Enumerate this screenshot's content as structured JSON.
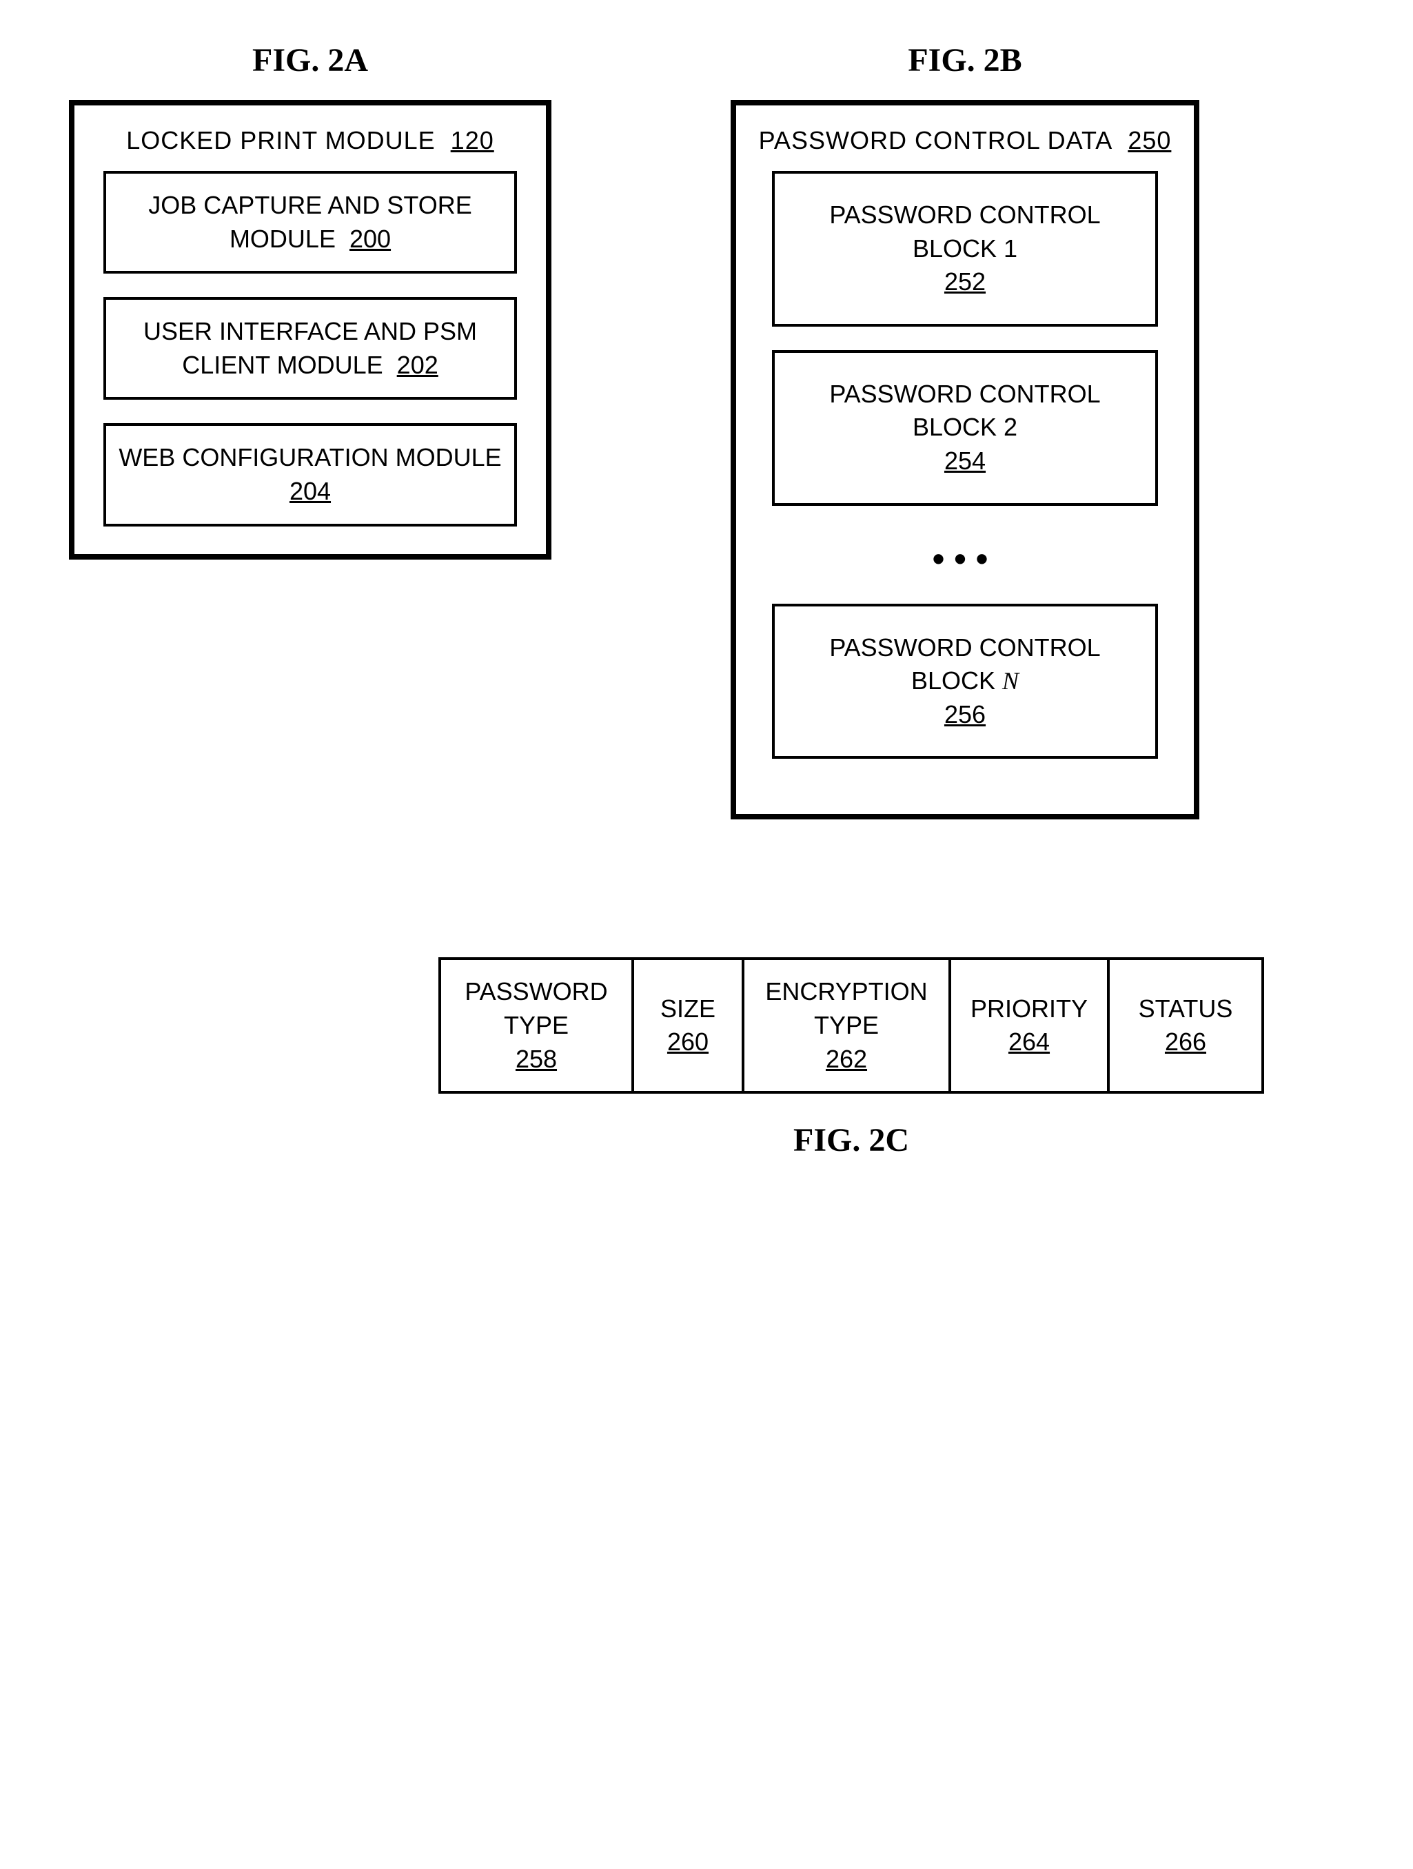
{
  "figA": {
    "label": "FIG. 2A",
    "header_text": "LOCKED PRINT MODULE",
    "header_num": "120",
    "boxes": [
      {
        "text": "JOB CAPTURE AND STORE MODULE",
        "num": "200"
      },
      {
        "text": "USER INTERFACE AND PSM CLIENT MODULE",
        "num": "202"
      },
      {
        "text": "WEB CONFIGURATION MODULE",
        "num": "204"
      }
    ]
  },
  "figB": {
    "label": "FIG. 2B",
    "header_text": "PASSWORD CONTROL DATA",
    "header_num": "250",
    "boxes": [
      {
        "text": "PASSWORD CONTROL BLOCK 1",
        "num": "252"
      },
      {
        "text": "PASSWORD CONTROL BLOCK 2",
        "num": "254"
      },
      {
        "text_prefix": "PASSWORD CONTROL BLOCK ",
        "text_suffix_italic": "N",
        "num": "256"
      }
    ]
  },
  "figC": {
    "label": "FIG. 2C",
    "cells": [
      {
        "text": "PASSWORD TYPE",
        "num": "258"
      },
      {
        "text": "SIZE",
        "num": "260"
      },
      {
        "text": "ENCRYPTION TYPE",
        "num": "262"
      },
      {
        "text": "PRIORITY",
        "num": "264"
      },
      {
        "text": "STATUS",
        "num": "266"
      }
    ]
  }
}
